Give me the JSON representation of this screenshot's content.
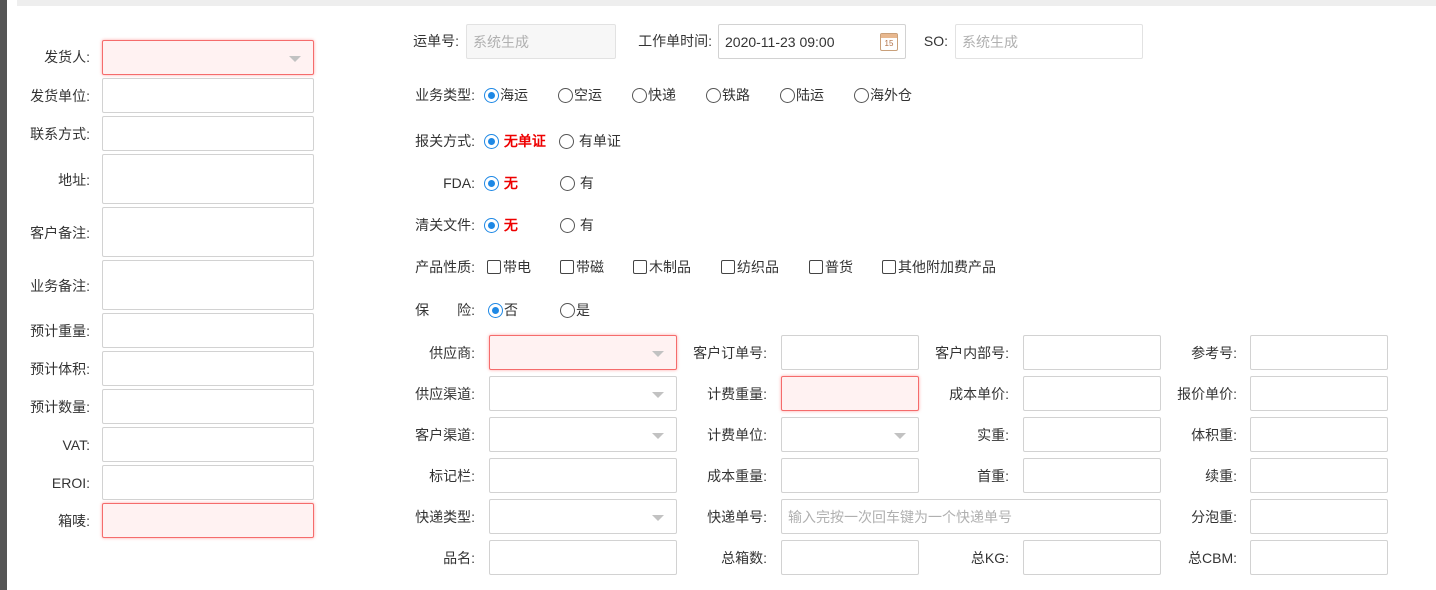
{
  "left": {
    "shipper_label": "发货人:",
    "shipper_unit_label": "发货单位:",
    "contact_label": "联系方式:",
    "address_label": "地址:",
    "customer_note_label": "客户备注:",
    "business_note_label": "业务备注:",
    "est_weight_label": "预计重量:",
    "est_volume_label": "预计体积:",
    "est_qty_label": "预计数量:",
    "vat_label": "VAT:",
    "eori_label": "EROI:",
    "mark_label": "箱唛:"
  },
  "top": {
    "waybill_label": "运单号:",
    "waybill_placeholder": "系统生成",
    "worktime_label": "工作单时间:",
    "worktime_value": "2020-11-23 09:00",
    "calendar_day": "15",
    "so_label": "SO:",
    "so_placeholder": "系统生成"
  },
  "business_type": {
    "label": "业务类型:",
    "options": [
      "海运",
      "空运",
      "快递",
      "铁路",
      "陆运",
      "海外仓"
    ],
    "selected": "海运"
  },
  "customs": {
    "label": "报关方式:",
    "options": [
      "无单证",
      "有单证"
    ],
    "selected": "无单证"
  },
  "fda": {
    "label": "FDA:",
    "options": [
      "无",
      "有"
    ],
    "selected": "无"
  },
  "clearance": {
    "label": "清关文件:",
    "options": [
      "无",
      "有"
    ],
    "selected": "无"
  },
  "product": {
    "label": "产品性质:",
    "options": [
      "带电",
      "带磁",
      "木制品",
      "纺织品",
      "普货",
      "其他附加费产品"
    ]
  },
  "insurance": {
    "label": "保　　险:",
    "options": [
      "否",
      "是"
    ],
    "selected": "否"
  },
  "grid": {
    "supplier_label": "供应商:",
    "customer_order_label": "客户订单号:",
    "customer_internal_label": "客户内部号:",
    "reference_label": "参考号:",
    "supply_channel_label": "供应渠道:",
    "charge_weight_label": "计费重量:",
    "cost_price_label": "成本单价:",
    "quote_price_label": "报价单价:",
    "customer_channel_label": "客户渠道:",
    "charge_unit_label": "计费单位:",
    "actual_weight_label": "实重:",
    "volume_weight_label": "体积重:",
    "mark_col_label": "标记栏:",
    "cost_weight_label": "成本重量:",
    "first_weight_label": "首重:",
    "extra_weight_label": "续重:",
    "express_type_label": "快递类型:",
    "express_no_label": "快递单号:",
    "express_no_placeholder": "输入完按一次回车键为一个快递单号",
    "bubble_weight_label": "分泡重:",
    "product_name_label": "品名:",
    "total_boxes_label": "总箱数:",
    "total_kg_label": "总KG:",
    "total_cbm_label": "总CBM:"
  }
}
